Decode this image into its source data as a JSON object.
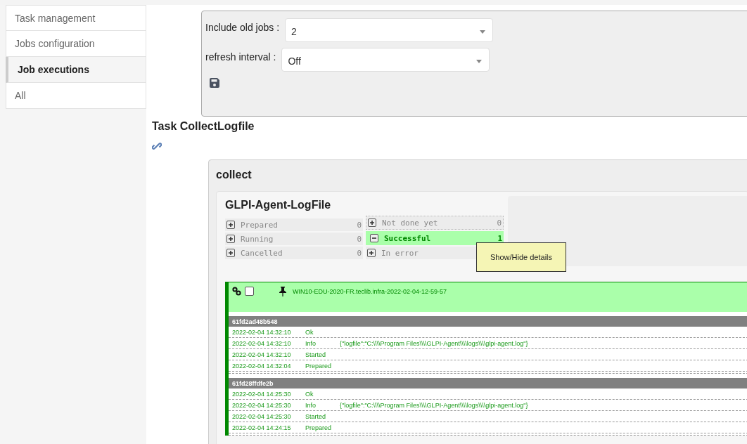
{
  "sidebar": {
    "items": [
      {
        "label": "Task management",
        "selected": false
      },
      {
        "label": "Jobs configuration",
        "selected": false
      },
      {
        "label": "Job executions",
        "selected": true
      },
      {
        "label": "All",
        "selected": false
      }
    ]
  },
  "filters": [
    {
      "label": "Include old jobs :",
      "value": "2"
    },
    {
      "label": "refresh interval :",
      "value": "Off"
    }
  ],
  "task": {
    "title": "Task CollectLogfile"
  },
  "job": {
    "title": "collect",
    "target": {
      "title": "GLPI-Agent-LogFile",
      "counters_left": [
        {
          "label": "Prepared",
          "count": "0",
          "expanded": false
        },
        {
          "label": "Running",
          "count": "0",
          "expanded": false
        },
        {
          "label": "Cancelled",
          "count": "0",
          "expanded": false
        }
      ],
      "counters_right": [
        {
          "label": "Not done yet",
          "count": "0",
          "expanded": false
        },
        {
          "label": "Successful",
          "count": "1",
          "expanded": true
        },
        {
          "label": "In error",
          "expanded": false
        }
      ],
      "tooltip": "Show/Hide details",
      "agent": {
        "checked": false,
        "name": "WIN10-EDU-2020-FR.teclib.infra-2022-02-04-12-59-57",
        "runs": [
          {
            "id": "61fd2ad48b548",
            "logs": [
              {
                "date": "2022-02-04 14:32:10",
                "state": "Ok"
              },
              {
                "date": "2022-02-04 14:32:10",
                "state": "Info",
                "comment": "{\"logfile\":\"C:\\\\\\\\Program Files\\\\\\\\GLPI-Agent\\\\\\\\logs\\\\\\\\glpi-agent.log\"}"
              },
              {
                "date": "2022-02-04 14:32:10",
                "state": "Started"
              },
              {
                "date": "2022-02-04 14:32:04",
                "state": "Prepared"
              }
            ]
          },
          {
            "id": "61fd28ffdfe2b",
            "logs": [
              {
                "date": "2022-02-04 14:25:30",
                "state": "Ok"
              },
              {
                "date": "2022-02-04 14:25:30",
                "state": "Info",
                "comment": "{\"logfile\":\"C:\\\\\\\\Program Files\\\\\\\\GLPI-Agent\\\\\\\\logs\\\\\\\\glpi-agent.log\"}"
              },
              {
                "date": "2022-02-04 14:25:30",
                "state": "Started"
              },
              {
                "date": "2022-02-04 14:24:15",
                "state": "Prepared"
              }
            ]
          }
        ]
      }
    }
  }
}
